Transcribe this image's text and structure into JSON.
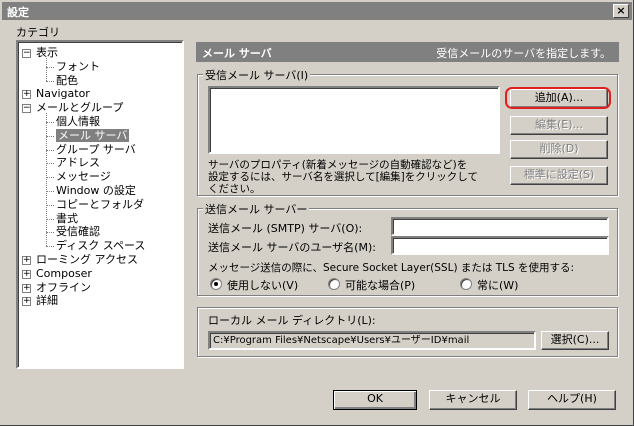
{
  "window": {
    "title": "設定",
    "close_glyph": "×"
  },
  "category_label": "カテゴリ",
  "tree": {
    "items": [
      {
        "label": "表示",
        "expander": "−"
      },
      {
        "label": "フォント"
      },
      {
        "label": "配色"
      },
      {
        "label": "Navigator",
        "expander": "+"
      },
      {
        "label": "メールとグループ",
        "expander": "−"
      },
      {
        "label": "個人情報"
      },
      {
        "label": "メール サーバ",
        "selected": true
      },
      {
        "label": "グループ サーバ"
      },
      {
        "label": "アドレス"
      },
      {
        "label": "メッセージ"
      },
      {
        "label": "Window の設定"
      },
      {
        "label": "コピーとフォルダ"
      },
      {
        "label": "書式"
      },
      {
        "label": "受信確認"
      },
      {
        "label": "ディスク スペース"
      },
      {
        "label": "ローミング アクセス",
        "expander": "+"
      },
      {
        "label": "Composer",
        "expander": "+"
      },
      {
        "label": "オフライン",
        "expander": "+"
      },
      {
        "label": "詳細",
        "expander": "+"
      }
    ]
  },
  "header": {
    "title": "メール サーバ",
    "description": "受信メールのサーバを指定します。"
  },
  "incoming": {
    "group_label": "受信メール サーバ(I)",
    "add_button": "追加(A)...",
    "edit_button": "編集(E)...",
    "delete_button": "削除(D)",
    "default_button": "標準に設定(S)",
    "hint_line1": "サーバのプロパティ(新着メッセージの自動確認など)を",
    "hint_line2": "設定するには、サーバ名を選択して[編集]をクリックして",
    "hint_line3": "ください。"
  },
  "outgoing": {
    "group_label": "送信メール サーバー",
    "smtp_label": "送信メール (SMTP) サーバ(O):",
    "smtp_value": "",
    "user_label": "送信メール サーバのユーザ名(M):",
    "user_value": "",
    "ssl_label": "メッセージ送信の際に、Secure Socket Layer(SSL) または TLS を使用する:",
    "radio_never": "使用しない(V)",
    "radio_possible": "可能な場合(P)",
    "radio_always": "常に(W)",
    "selected": "never"
  },
  "local": {
    "group_label": "ローカル メール ディレクトリ(L):",
    "path_value": "C:¥Program Files¥Netscape¥Users¥ユーザーID¥mail",
    "choose_button": "選択(C)..."
  },
  "footer": {
    "ok": "OK",
    "cancel": "キャンセル",
    "help": "ヘルプ(H)"
  },
  "colors": {
    "highlight_ring": "#e02020",
    "header_bg": "#808080",
    "dialog_bg": "#d4d0c8"
  }
}
